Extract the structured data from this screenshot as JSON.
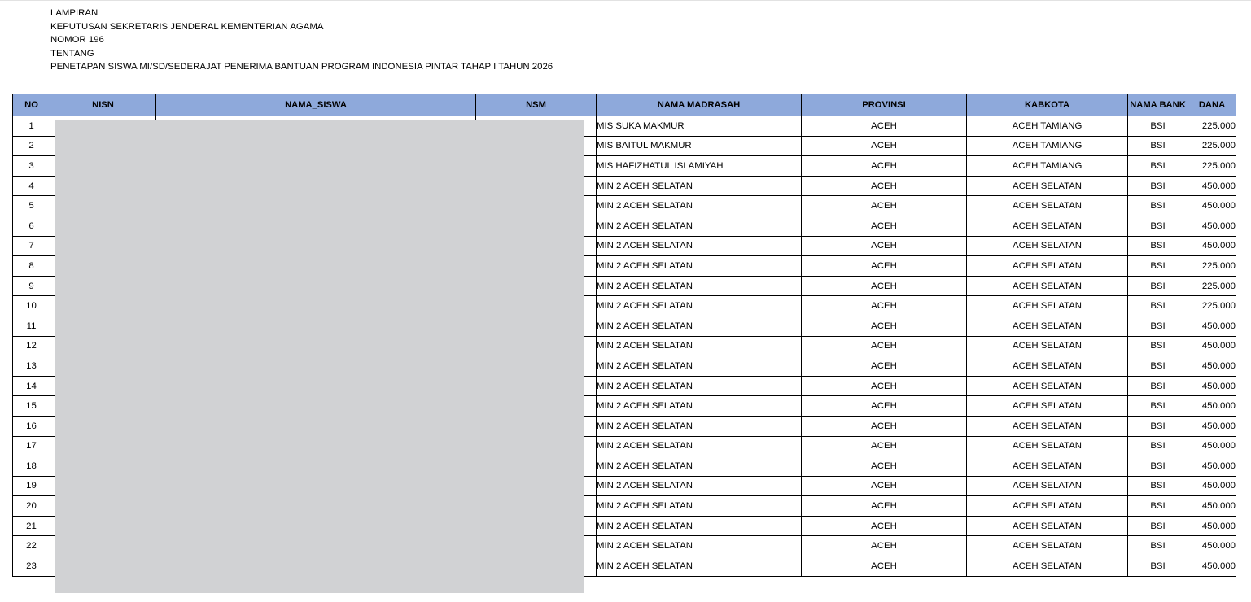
{
  "header": {
    "line1": "LAMPIRAN",
    "line2": "KEPUTUSAN SEKRETARIS JENDERAL KEMENTERIAN AGAMA",
    "line3": "NOMOR 196",
    "line4": "TENTANG",
    "line5": "PENETAPAN SISWA MI/SD/SEDERAJAT PENERIMA BANTUAN PROGRAM INDONESIA PINTAR TAHAP I TAHUN 2026"
  },
  "table": {
    "columns": [
      "NO",
      "NISN",
      "NAMA_SISWA",
      "NSM",
      "NAMA MADRASAH",
      "PROVINSI",
      "KABKOTA",
      "NAMA BANK",
      "DANA"
    ],
    "rows": [
      {
        "no": "1",
        "nisn": "",
        "nama_siswa": "",
        "nsm": "",
        "madrasah": "MIS SUKA MAKMUR",
        "provinsi": "ACEH",
        "kabkota": "ACEH TAMIANG",
        "bank": "BSI",
        "dana": "225.000"
      },
      {
        "no": "2",
        "nisn": "",
        "nama_siswa": "",
        "nsm": "",
        "madrasah": "MIS BAITUL MAKMUR",
        "provinsi": "ACEH",
        "kabkota": "ACEH TAMIANG",
        "bank": "BSI",
        "dana": "225.000"
      },
      {
        "no": "3",
        "nisn": "",
        "nama_siswa": "",
        "nsm": "",
        "madrasah": "MIS HAFIZHATUL ISLAMIYAH",
        "provinsi": "ACEH",
        "kabkota": "ACEH TAMIANG",
        "bank": "BSI",
        "dana": "225.000"
      },
      {
        "no": "4",
        "nisn": "",
        "nama_siswa": "",
        "nsm": "",
        "madrasah": "MIN 2 ACEH SELATAN",
        "provinsi": "ACEH",
        "kabkota": "ACEH SELATAN",
        "bank": "BSI",
        "dana": "450.000"
      },
      {
        "no": "5",
        "nisn": "",
        "nama_siswa": "",
        "nsm": "",
        "madrasah": "MIN 2 ACEH SELATAN",
        "provinsi": "ACEH",
        "kabkota": "ACEH SELATAN",
        "bank": "BSI",
        "dana": "450.000"
      },
      {
        "no": "6",
        "nisn": "",
        "nama_siswa": "",
        "nsm": "",
        "madrasah": "MIN 2 ACEH SELATAN",
        "provinsi": "ACEH",
        "kabkota": "ACEH SELATAN",
        "bank": "BSI",
        "dana": "450.000"
      },
      {
        "no": "7",
        "nisn": "",
        "nama_siswa": "",
        "nsm": "",
        "madrasah": "MIN 2 ACEH SELATAN",
        "provinsi": "ACEH",
        "kabkota": "ACEH SELATAN",
        "bank": "BSI",
        "dana": "450.000"
      },
      {
        "no": "8",
        "nisn": "",
        "nama_siswa": "",
        "nsm": "",
        "madrasah": "MIN 2 ACEH SELATAN",
        "provinsi": "ACEH",
        "kabkota": "ACEH SELATAN",
        "bank": "BSI",
        "dana": "225.000"
      },
      {
        "no": "9",
        "nisn": "",
        "nama_siswa": "",
        "nsm": "",
        "madrasah": "MIN 2 ACEH SELATAN",
        "provinsi": "ACEH",
        "kabkota": "ACEH SELATAN",
        "bank": "BSI",
        "dana": "225.000"
      },
      {
        "no": "10",
        "nisn": "",
        "nama_siswa": "",
        "nsm": "",
        "madrasah": "MIN 2 ACEH SELATAN",
        "provinsi": "ACEH",
        "kabkota": "ACEH SELATAN",
        "bank": "BSI",
        "dana": "225.000"
      },
      {
        "no": "11",
        "nisn": "",
        "nama_siswa": "",
        "nsm": "",
        "madrasah": "MIN 2 ACEH SELATAN",
        "provinsi": "ACEH",
        "kabkota": "ACEH SELATAN",
        "bank": "BSI",
        "dana": "450.000"
      },
      {
        "no": "12",
        "nisn": "",
        "nama_siswa": "",
        "nsm": "",
        "madrasah": "MIN 2 ACEH SELATAN",
        "provinsi": "ACEH",
        "kabkota": "ACEH SELATAN",
        "bank": "BSI",
        "dana": "450.000"
      },
      {
        "no": "13",
        "nisn": "",
        "nama_siswa": "",
        "nsm": "",
        "madrasah": "MIN 2 ACEH SELATAN",
        "provinsi": "ACEH",
        "kabkota": "ACEH SELATAN",
        "bank": "BSI",
        "dana": "450.000"
      },
      {
        "no": "14",
        "nisn": "",
        "nama_siswa": "",
        "nsm": "",
        "madrasah": "MIN 2 ACEH SELATAN",
        "provinsi": "ACEH",
        "kabkota": "ACEH SELATAN",
        "bank": "BSI",
        "dana": "450.000"
      },
      {
        "no": "15",
        "nisn": "",
        "nama_siswa": "",
        "nsm": "",
        "madrasah": "MIN 2 ACEH SELATAN",
        "provinsi": "ACEH",
        "kabkota": "ACEH SELATAN",
        "bank": "BSI",
        "dana": "450.000"
      },
      {
        "no": "16",
        "nisn": "",
        "nama_siswa": "",
        "nsm": "",
        "madrasah": "MIN 2 ACEH SELATAN",
        "provinsi": "ACEH",
        "kabkota": "ACEH SELATAN",
        "bank": "BSI",
        "dana": "450.000"
      },
      {
        "no": "17",
        "nisn": "",
        "nama_siswa": "",
        "nsm": "",
        "madrasah": "MIN 2 ACEH SELATAN",
        "provinsi": "ACEH",
        "kabkota": "ACEH SELATAN",
        "bank": "BSI",
        "dana": "450.000"
      },
      {
        "no": "18",
        "nisn": "",
        "nama_siswa": "",
        "nsm": "",
        "madrasah": "MIN 2 ACEH SELATAN",
        "provinsi": "ACEH",
        "kabkota": "ACEH SELATAN",
        "bank": "BSI",
        "dana": "450.000"
      },
      {
        "no": "19",
        "nisn": "",
        "nama_siswa": "",
        "nsm": "",
        "madrasah": "MIN 2 ACEH SELATAN",
        "provinsi": "ACEH",
        "kabkota": "ACEH SELATAN",
        "bank": "BSI",
        "dana": "450.000"
      },
      {
        "no": "20",
        "nisn": "",
        "nama_siswa": "",
        "nsm": "",
        "madrasah": "MIN 2 ACEH SELATAN",
        "provinsi": "ACEH",
        "kabkota": "ACEH SELATAN",
        "bank": "BSI",
        "dana": "450.000"
      },
      {
        "no": "21",
        "nisn": "",
        "nama_siswa": "",
        "nsm": "",
        "madrasah": "MIN 2 ACEH SELATAN",
        "provinsi": "ACEH",
        "kabkota": "ACEH SELATAN",
        "bank": "BSI",
        "dana": "450.000"
      },
      {
        "no": "22",
        "nisn": "",
        "nama_siswa": "",
        "nsm": "",
        "madrasah": "MIN 2 ACEH SELATAN",
        "provinsi": "ACEH",
        "kabkota": "ACEH SELATAN",
        "bank": "BSI",
        "dana": "450.000"
      },
      {
        "no": "23",
        "nisn": "",
        "nama_siswa": "",
        "nsm": "",
        "madrasah": "MIN 2 ACEH SELATAN",
        "provinsi": "ACEH",
        "kabkota": "ACEH SELATAN",
        "bank": "BSI",
        "dana": "450.000"
      }
    ]
  },
  "colors": {
    "header_fill": "#8ea9db",
    "redaction": "#d1d2d4"
  }
}
